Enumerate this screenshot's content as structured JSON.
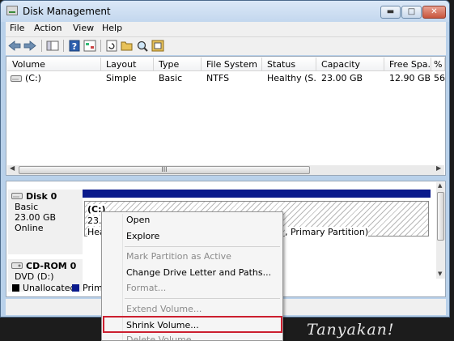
{
  "window": {
    "title": "Disk Management"
  },
  "menu": [
    "File",
    "Action",
    "View",
    "Help"
  ],
  "toolbar_icons": [
    "back-arrow-icon",
    "forward-arrow-icon",
    "console-tree-icon",
    "help-icon",
    "properties-icon",
    "refresh-icon",
    "open-folder-icon",
    "search-icon",
    "export-icon"
  ],
  "volumes": {
    "headers": [
      "Volume",
      "Layout",
      "Type",
      "File System",
      "Status",
      "Capacity",
      "Free Spa...",
      "% F"
    ],
    "rows": [
      [
        "(C:)",
        "Simple",
        "Basic",
        "NTFS",
        "Healthy (S...",
        "23.00 GB",
        "12.90 GB",
        "56"
      ]
    ],
    "scroll_thumb": "III"
  },
  "disk0": {
    "name": "Disk 0",
    "type": "Basic",
    "size": "23.00 GB",
    "status": "Online",
    "partition_label": "(C:)",
    "partition_size": "23.0",
    "partition_status_start": "Hea",
    "partition_status_end": ", Primary Partition)"
  },
  "cdrom0": {
    "name": "CD-ROM 0",
    "drive": "DVD (D:)"
  },
  "legend": {
    "unallocated": "Unallocated",
    "primary": "Prima",
    "colors": {
      "unallocated": "#000000",
      "primary": "#0a1a8c"
    }
  },
  "context_menu": {
    "open": "Open",
    "explore": "Explore",
    "mark_active": "Mark Partition as Active",
    "change_letter": "Change Drive Letter and Paths...",
    "format": "Format...",
    "extend": "Extend Volume...",
    "shrink": "Shrink Volume...",
    "delete": "Delete Volume..."
  },
  "colors": {
    "highlight_border": "#cc1f2f",
    "disk_bar": "#0a1a8c"
  },
  "watermark": "Tanyakan!"
}
